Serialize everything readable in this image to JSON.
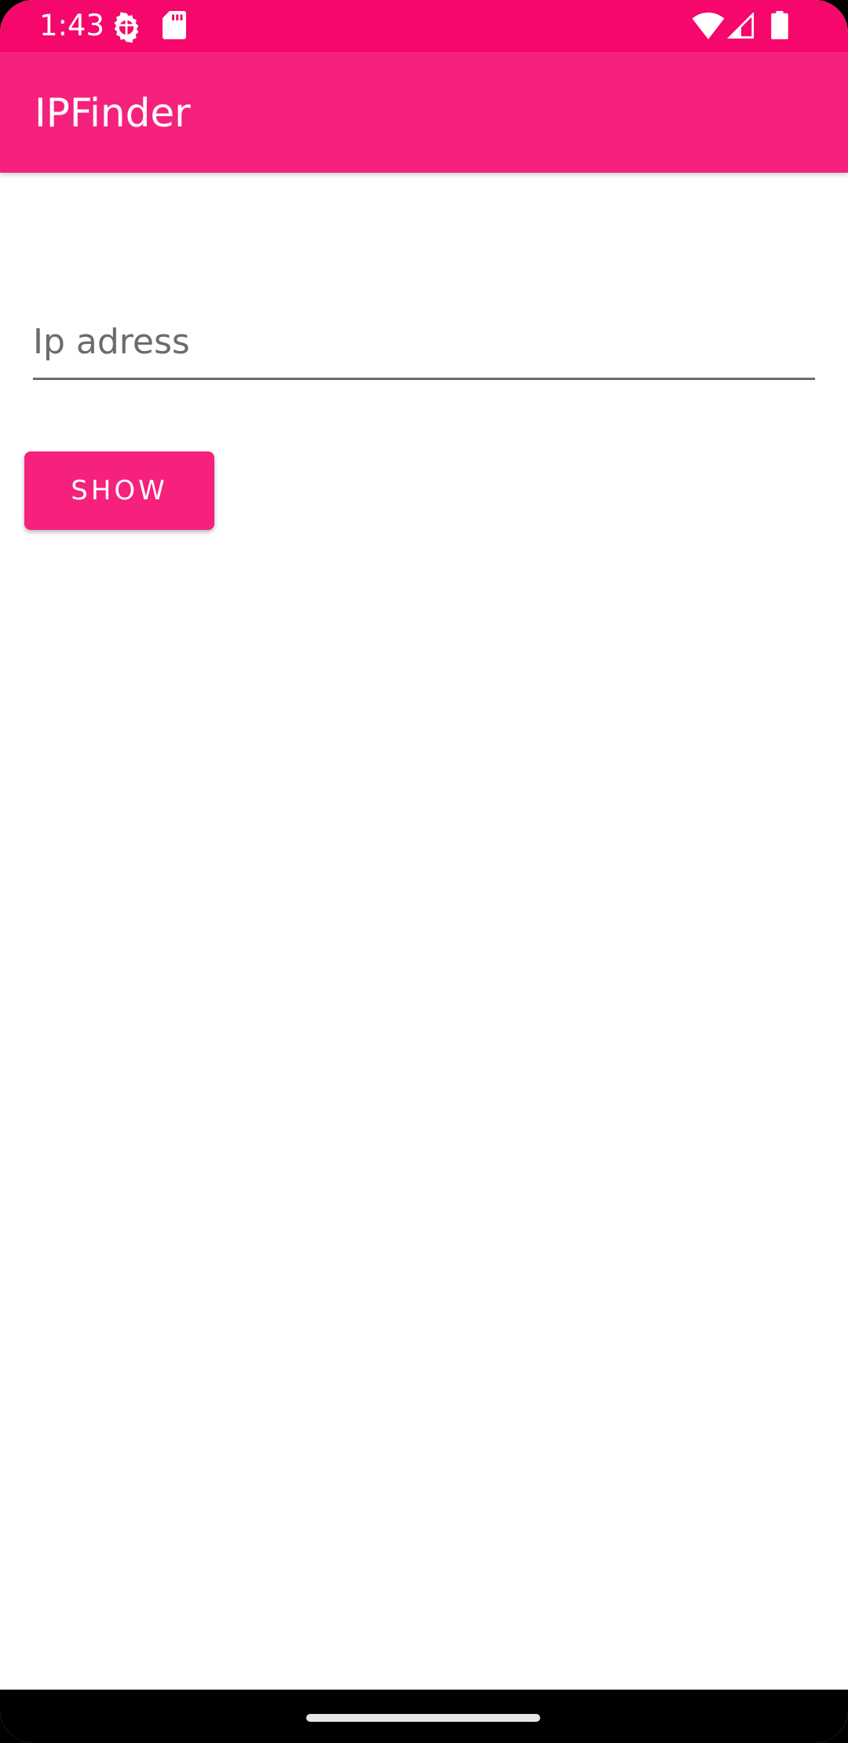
{
  "status_bar": {
    "time": "1:43",
    "icons": [
      "settings-gear-icon",
      "sd-card-icon",
      "wifi-icon",
      "cell-signal-icon",
      "battery-icon"
    ],
    "background_color": "#f6076b"
  },
  "app_bar": {
    "title": "IPFinder",
    "background_color": "#f5217c"
  },
  "form": {
    "ip_input": {
      "placeholder": "Ip adress",
      "value": ""
    },
    "show_button_label": "SHOW"
  },
  "theme": {
    "accent": "#f5217c",
    "text_on_accent": "#ffffff",
    "hint_text": "#6b6b6b"
  }
}
